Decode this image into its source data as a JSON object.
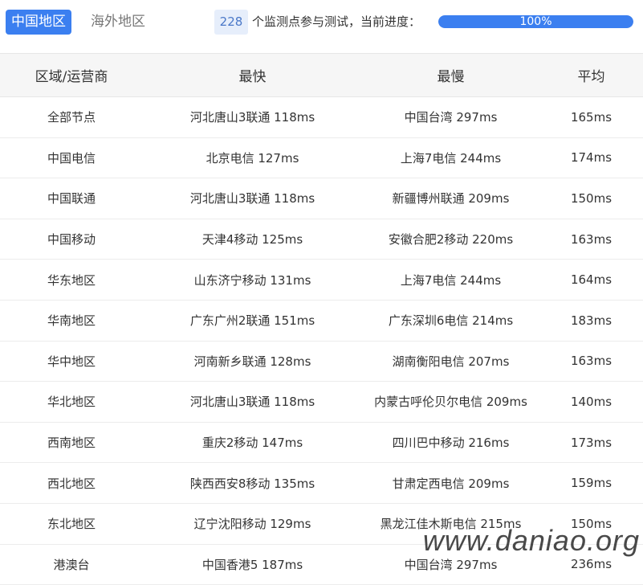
{
  "tabs": {
    "china": "中国地区",
    "overseas": "海外地区"
  },
  "progress": {
    "node_count": "228",
    "label": "个监测点参与测试，当前进度：",
    "percent": 100,
    "percent_text": "100%"
  },
  "table": {
    "headers": [
      "区域/运营商",
      "最快",
      "最慢",
      "平均"
    ],
    "rows": [
      [
        "全部节点",
        "河北唐山3联通 118ms",
        "中国台湾 297ms",
        "165ms"
      ],
      [
        "中国电信",
        "北京电信 127ms",
        "上海7电信 244ms",
        "174ms"
      ],
      [
        "中国联通",
        "河北唐山3联通 118ms",
        "新疆博州联通 209ms",
        "150ms"
      ],
      [
        "中国移动",
        "天津4移动 125ms",
        "安徽合肥2移动 220ms",
        "163ms"
      ],
      [
        "华东地区",
        "山东济宁移动 131ms",
        "上海7电信 244ms",
        "164ms"
      ],
      [
        "华南地区",
        "广东广州2联通 151ms",
        "广东深圳6电信 214ms",
        "183ms"
      ],
      [
        "华中地区",
        "河南新乡联通 128ms",
        "湖南衡阳电信 207ms",
        "163ms"
      ],
      [
        "华北地区",
        "河北唐山3联通 118ms",
        "内蒙古呼伦贝尔电信 209ms",
        "140ms"
      ],
      [
        "西南地区",
        "重庆2移动 147ms",
        "四川巴中移动 216ms",
        "173ms"
      ],
      [
        "西北地区",
        "陕西西安8移动 135ms",
        "甘肃定西电信 209ms",
        "159ms"
      ],
      [
        "东北地区",
        "辽宁沈阳移动 129ms",
        "黑龙江佳木斯电信 215ms",
        "150ms"
      ],
      [
        "港澳台",
        "中国香港5 187ms",
        "中国台湾 297ms",
        "236ms"
      ]
    ]
  },
  "watermark": "www.daniao.org",
  "colors": {
    "accent": "#3b7ff0",
    "badge_bg": "#e6eefb",
    "header_bg": "#f6f6f6"
  }
}
